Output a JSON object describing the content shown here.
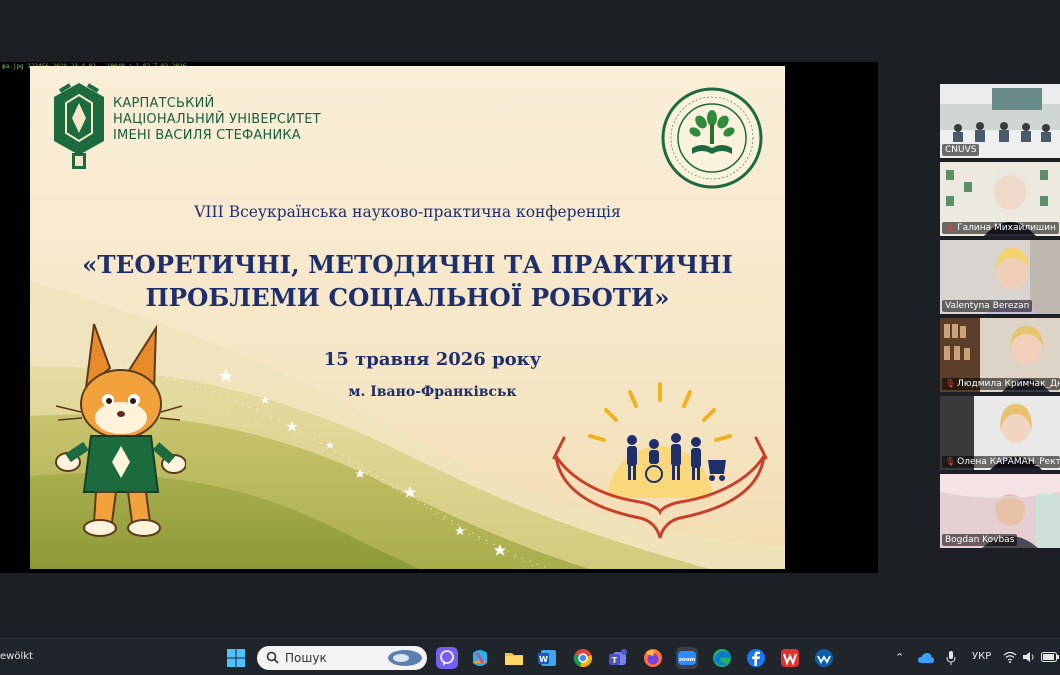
{
  "shared_screen": {
    "caption": "фа.jpg  123456 2024-23-4-02 - 10040 / 1-02 7 03 2026",
    "slide": {
      "university_lines": [
        "КАРПАТСЬКИЙ",
        "НАЦІОНАЛЬНИЙ УНІВЕРСИТЕТ",
        "ІМЕНІ ВАСИЛЯ СТЕФАНИКА"
      ],
      "conference_line": "VIII Всеукраїнська науково-практична конференція",
      "title_lines": [
        "«ТЕОРЕТИЧНІ, МЕТОДИЧНІ ТА ПРАКТИЧНІ",
        "ПРОБЛЕМИ СОЦІАЛЬНОЇ РОБОТИ»"
      ],
      "date": "15  травня 2026 року",
      "city": "м. Івано-Франківськ"
    }
  },
  "participants": [
    {
      "name": "CNUVS",
      "muted": false,
      "active": true
    },
    {
      "name": "Галина Михайлишин",
      "muted": true,
      "active": false
    },
    {
      "name": "Valentyna Berezan",
      "muted": false,
      "active": false
    },
    {
      "name": "Людмила Кримчак_Дн",
      "muted": true,
      "active": false
    },
    {
      "name": "Олена КАРАМАН_Рект",
      "muted": true,
      "active": false
    },
    {
      "name": "Bogdan Kovbas",
      "muted": false,
      "active": false
    }
  ],
  "taskbar": {
    "weather_text": "ewölkt",
    "search_placeholder": "Пошук",
    "apps": [
      "viber-icon",
      "copilot-icon",
      "file-explorer-icon",
      "word-icon",
      "chrome-icon",
      "teams-icon",
      "firefox-icon",
      "zoom-icon",
      "edge-icon",
      "facebook-icon",
      "wps-icon",
      "windscribe-icon"
    ],
    "tray": {
      "language": "УКР"
    }
  }
}
